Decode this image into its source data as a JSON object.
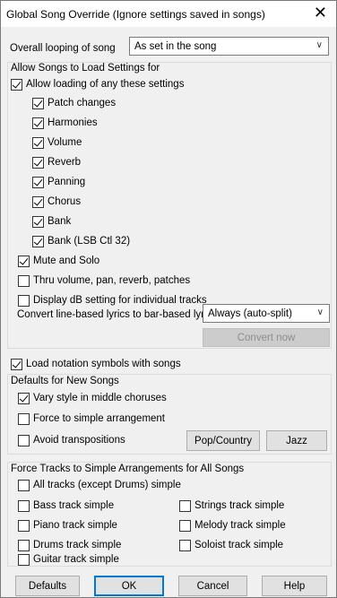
{
  "window": {
    "title": "Global Song Override (Ignore settings saved in songs)",
    "close_glyph": "✕"
  },
  "looping": {
    "label": "Overall looping of song",
    "value": "As set in the song"
  },
  "allow_group": {
    "title": "Allow Songs to Load Settings for",
    "allow_all": {
      "label": "Allow loading of any these settings",
      "checked": true
    },
    "items": [
      {
        "label": "Patch changes",
        "checked": true
      },
      {
        "label": "Harmonies",
        "checked": true
      },
      {
        "label": "Volume",
        "checked": true
      },
      {
        "label": "Reverb",
        "checked": true
      },
      {
        "label": "Panning",
        "checked": true
      },
      {
        "label": "Chorus",
        "checked": true
      },
      {
        "label": "Bank",
        "checked": true
      },
      {
        "label": "Bank (LSB Ctl 32)",
        "checked": true
      }
    ],
    "mute_solo": {
      "label": "Mute and Solo",
      "checked": true
    },
    "thru_volume": {
      "label": "Thru volume, pan, reverb, patches",
      "checked": false
    },
    "display_db": {
      "label": "Display dB setting for individual tracks",
      "checked": false
    },
    "convert_lyrics": {
      "label": "Convert line-based lyrics to bar-based lyrics",
      "value": "Always (auto-split)"
    },
    "convert_now": "Convert now"
  },
  "load_notation": {
    "label": "Load notation symbols with songs",
    "checked": true
  },
  "defaults_group": {
    "title": "Defaults for New Songs",
    "vary_style": {
      "label": "Vary style in middle choruses",
      "checked": true
    },
    "force_simple": {
      "label": "Force to simple arrangement",
      "checked": false
    },
    "avoid_trans": {
      "label": "Avoid transpositions",
      "checked": false
    },
    "pop_country": "Pop/Country",
    "jazz": "Jazz"
  },
  "force_group": {
    "title": "Force Tracks to Simple Arrangements for All Songs",
    "all_tracks": {
      "label": "All tracks (except Drums) simple",
      "checked": false
    },
    "bass": {
      "label": "Bass track simple",
      "checked": false
    },
    "strings": {
      "label": "Strings track simple",
      "checked": false
    },
    "piano": {
      "label": "Piano track simple",
      "checked": false
    },
    "melody": {
      "label": "Melody track simple",
      "checked": false
    },
    "drums": {
      "label": "Drums track simple",
      "checked": false
    },
    "soloist": {
      "label": "Soloist track simple",
      "checked": false
    },
    "guitar": {
      "label": "Guitar track simple",
      "checked": false
    }
  },
  "buttons": {
    "defaults": "Defaults",
    "ok": "OK",
    "cancel": "Cancel",
    "help": "Help"
  }
}
